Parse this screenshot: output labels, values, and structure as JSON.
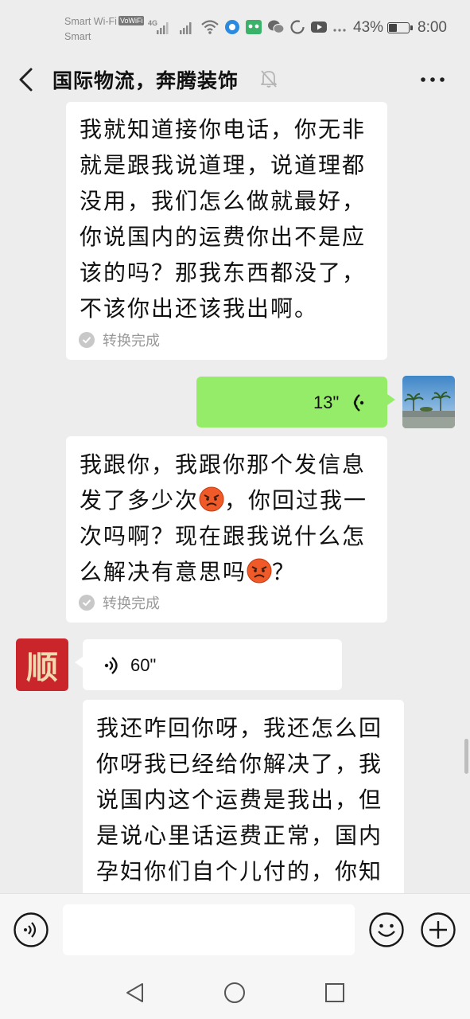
{
  "status_bar": {
    "carrier_line1": "Smart Wi-Fi",
    "vowifi_badge": "VoWiFi",
    "carrier_line2": "Smart",
    "network_type": "4G",
    "battery_percent_text": "43%",
    "battery_level": 0.43,
    "time": "8:00"
  },
  "header": {
    "back_icon": "chevron-left-icon",
    "title": "国际物流，奔腾装饰",
    "mute_icon": "bell-off-icon",
    "more_icon": "more-dots-icon"
  },
  "messages": [
    {
      "side": "left",
      "type": "voice-transcript",
      "text": "我就知道接你电话，你无非\n就是跟我说道理，说道理都\n没用，我们怎么做就最好，\n你说国内的运费你出不是应\n该的吗？那我东西都没了，\n不该你出还该我出啊。",
      "status": "转换完成"
    },
    {
      "side": "right",
      "type": "voice",
      "duration": "13\""
    },
    {
      "side": "left",
      "type": "voice-transcript",
      "text_parts": [
        "我跟你，我跟你那个发信息\n发了多少次",
        "，你回过我一\n次吗啊？现在跟我说什么怎\n么解决有意思吗",
        "？"
      ],
      "emoji": "angry-face-icon",
      "status": "转换完成"
    },
    {
      "side": "left",
      "type": "voice",
      "duration": "60\"",
      "avatar_text": "顺"
    },
    {
      "side": "left",
      "type": "voice-transcript",
      "text": "我还咋回你呀，我还怎么回\n你呀我已经给你解决了，我\n说国内这个运费是我出，但\n是说心里话运费正常，国内\n孕妇你们自个儿付的，你知"
    }
  ],
  "input_bar": {
    "voice_icon": "voice-input-icon",
    "placeholder": "",
    "emoji_icon": "emoji-icon",
    "plus_icon": "plus-circle-icon"
  },
  "nav_bar": {
    "back": "nav-back-icon",
    "home": "nav-home-icon",
    "recents": "nav-recents-icon"
  }
}
